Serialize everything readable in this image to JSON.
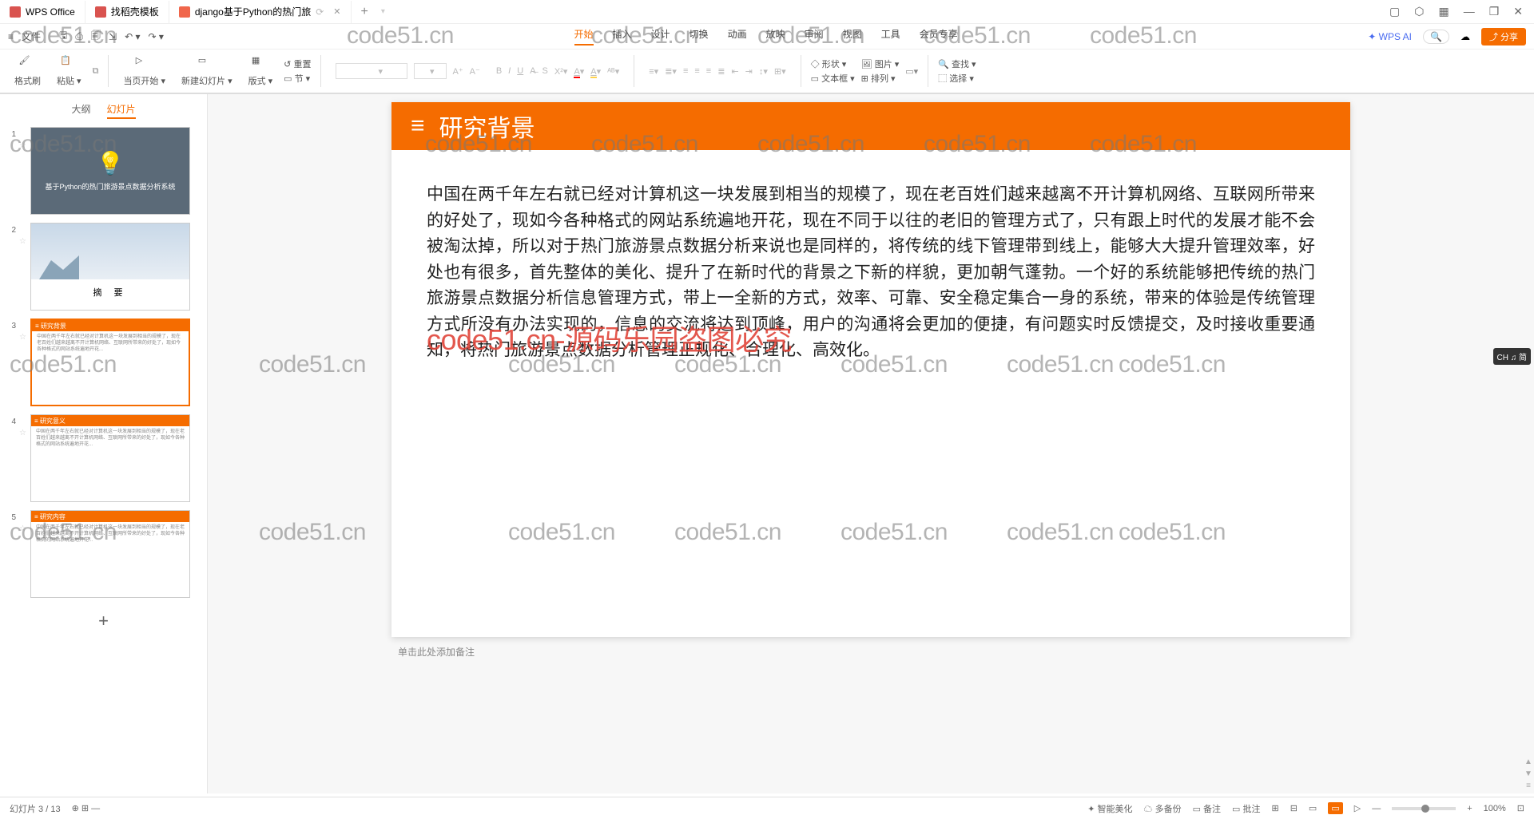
{
  "tabs": [
    {
      "icon": "wps",
      "label": "WPS Office"
    },
    {
      "icon": "dao",
      "label": "找稻壳模板"
    },
    {
      "icon": "ppt",
      "label": "django基于Python的热门旅"
    }
  ],
  "menu": {
    "file": "文件",
    "items": [
      "开始",
      "插入",
      "设计",
      "切换",
      "动画",
      "放映",
      "审阅",
      "视图",
      "工具",
      "会员专享"
    ],
    "active": "开始",
    "wpsai": "WPS AI",
    "share": "分享"
  },
  "ribbon": {
    "fmt": "格式刷",
    "paste": "粘贴",
    "startpg": "当页开始",
    "newslide": "新建幻灯片",
    "layout": "版式",
    "reset": "重置",
    "section": "节",
    "shape": "形状",
    "picture": "图片",
    "textbox": "文本框",
    "arrange": "排列",
    "find": "查找",
    "select": "选择"
  },
  "sidepanel": {
    "tabs": {
      "outline": "大纲",
      "slides": "幻灯片"
    },
    "slide1_title": "基于Python的热门旅游景点数据分析系统",
    "slide2_caption": "摘    要",
    "slide3_hdr": "研究背景",
    "slide4_hdr": "研究意义",
    "slide5_hdr": "研究内容",
    "thumbbody": "中国在两千年左右就已经对计算机这一块发展到相当的规模了，现在老百姓们越来越离不开计算机网络、互联网所带来的好处了，现如今各种格式的网站系统遍地开花..."
  },
  "slide": {
    "title": "研究背景",
    "body": "中国在两千年左右就已经对计算机这一块发展到相当的规模了，现在老百姓们越来越离不开计算机网络、互联网所带来的好处了，现如今各种格式的网站系统遍地开花，现在不同于以往的老旧的管理方式了，只有跟上时代的发展才能不会被淘汰掉，所以对于热门旅游景点数据分析来说也是同样的，将传统的线下管理带到线上，能够大大提升管理效率，好处也有很多，首先整体的美化、提升了在新时代的背景之下新的样貌，更加朝气蓬勃。一个好的系统能够把传统的热门旅游景点数据分析信息管理方式，带上一全新的方式，效率、可靠、安全稳定集合一身的系统，带来的体验是传统管理方式所没有办法实现的，信息的交流将达到顶峰，用户的沟通将会更加的便捷，有问题实时反馈提交，及时接收重要通知，将热门旅游景点数据分析管理正规化、合理化、高效化。"
  },
  "notes": "单击此处添加备注",
  "status": {
    "left": "幻灯片 3 / 13",
    "ai": "智能美化",
    "duobei": "多备份",
    "note": "备注",
    "cmt": "批注",
    "zoom": "100%"
  },
  "wm": {
    "small": "code51.cn",
    "big": "code51.cn-源码乐园盗图必究"
  },
  "ime": "CH ♫ 简"
}
